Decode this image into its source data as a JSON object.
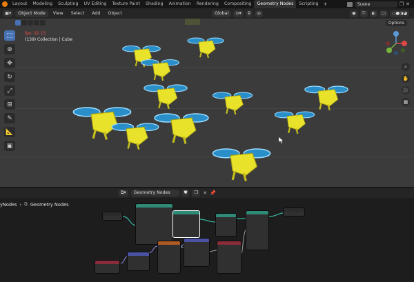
{
  "workspace_tabs": [
    "Layout",
    "Modeling",
    "Sculpting",
    "UV Editing",
    "Texture Paint",
    "Shading",
    "Animation",
    "Rendering",
    "Compositing",
    "Geometry Nodes",
    "Scripting"
  ],
  "active_tab_index": 9,
  "scene": {
    "label": "Scene"
  },
  "viewport_header": {
    "mode": "Object Mode",
    "menus": [
      "View",
      "Select",
      "Add",
      "Object"
    ],
    "orientation": "Global",
    "options": "Options"
  },
  "viewport": {
    "fps": "fps: 22.15",
    "collection": "(139) Collection | Cube"
  },
  "node_editor": {
    "header_title": "Geometry Nodes",
    "breadcrumb": [
      "yNodes",
      "Geometry Nodes"
    ]
  },
  "colors": {
    "accent": "#4772b3",
    "active_tab": "#303030",
    "fps": "#ff4a4a"
  },
  "icons": [
    "blender-logo-icon",
    "select-box-icon",
    "cursor-icon",
    "move-icon",
    "rotate-icon",
    "scale-icon",
    "transform-icon",
    "annotate-icon",
    "measure-icon",
    "add-cube-icon",
    "zoom-icon",
    "hand-icon",
    "camera-icon",
    "grid-icon"
  ]
}
